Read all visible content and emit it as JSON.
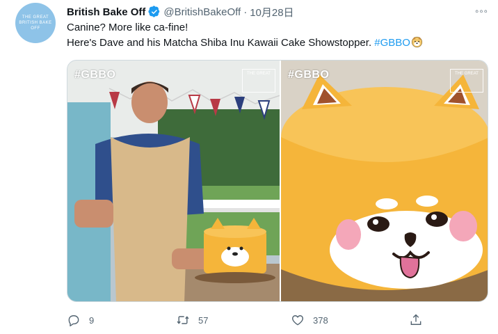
{
  "tweet": {
    "author_name": "British Bake Off",
    "handle": "@BritishBakeOff",
    "separator": "·",
    "time": "10月28日",
    "more": "◦◦◦",
    "avatar_text": "THE GREAT BRITISH BAKE OFF",
    "line1": "Canine? More like ca-fine!",
    "line2": "Here's Dave and his Matcha Shiba Inu Kawaii Cake Showstopper.",
    "hashtag": "#GBBO",
    "emoji": "dog-face-emoji"
  },
  "media": {
    "left_tag": "#GBBO",
    "right_tag": "#GBBO",
    "watermark": "THE GREAT BRITISH BAKE OFF"
  },
  "actions": {
    "reply_count": "9",
    "retweet_count": "57",
    "like_count": "378",
    "share_count": ""
  },
  "colors": {
    "link": "#1d9bf0",
    "secondary_text": "#536471",
    "verified": "#1d9bf0",
    "cake": "#f5b53a"
  }
}
